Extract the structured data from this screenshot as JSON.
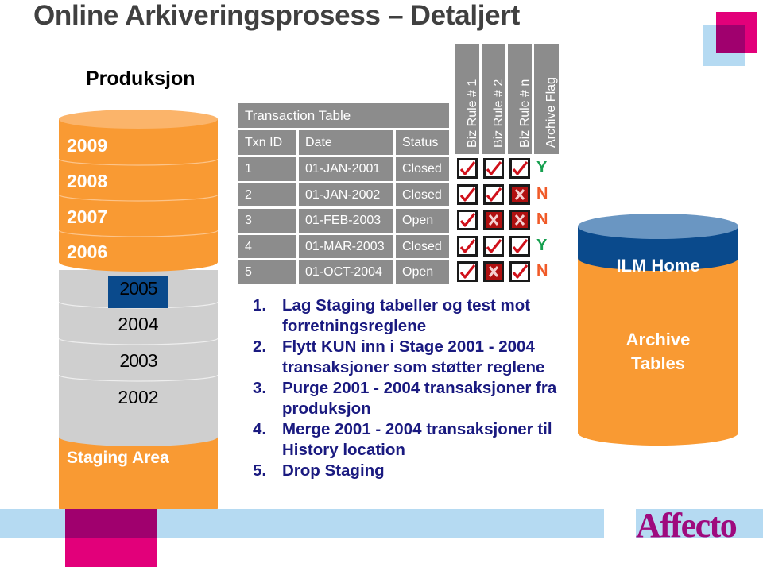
{
  "title": "Online Arkiveringsprosess – Detaljert",
  "production": {
    "label": "Produksjon",
    "years_active": [
      "2009",
      "2008",
      "2007",
      "2006"
    ],
    "year_highlight": "2005",
    "years_staged": [
      "2004",
      "2003",
      "2002"
    ],
    "staging_label": "Staging Area"
  },
  "transaction_table": {
    "title": "Transaction Table",
    "columns": [
      "Txn ID",
      "Date",
      "Status"
    ],
    "rule_columns": [
      "Biz Rule # 1",
      "Biz Rule # 2",
      "Biz Rule # n",
      "Archive Flag"
    ],
    "rows": [
      {
        "id": "1",
        "date": "01-JAN-2001",
        "status": "Closed",
        "rules": [
          true,
          true,
          true
        ],
        "flag": "Y"
      },
      {
        "id": "2",
        "date": "01-JAN-2002",
        "status": "Closed",
        "rules": [
          true,
          true,
          false
        ],
        "flag": "N"
      },
      {
        "id": "3",
        "date": "01-FEB-2003",
        "status": "Open",
        "rules": [
          true,
          false,
          false
        ],
        "flag": "N"
      },
      {
        "id": "4",
        "date": "01-MAR-2003",
        "status": "Closed",
        "rules": [
          true,
          true,
          true
        ],
        "flag": "Y"
      },
      {
        "id": "5",
        "date": "01-OCT-2004",
        "status": "Open",
        "rules": [
          true,
          false,
          true
        ],
        "flag": "N"
      }
    ]
  },
  "steps": [
    {
      "num": "1.",
      "text": "Lag Staging tabeller og test mot forretningsreglene"
    },
    {
      "num": "2.",
      "text": "Flytt KUN inn i Stage 2001 - 2004 transaksjoner som støtter reglene"
    },
    {
      "num": "3.",
      "text": "Purge 2001 - 2004 transaksjoner fra produksjon"
    },
    {
      "num": "4.",
      "text": "Merge 2001 - 2004 transaksjoner til History location"
    },
    {
      "num": "5.",
      "text": "Drop Staging"
    }
  ],
  "ilm": {
    "home_label": "ILM Home",
    "archive_label_line1": "Archive",
    "archive_label_line2": "Tables"
  },
  "brand": {
    "logo_text": "Affecto"
  },
  "colors": {
    "orange": "#f99a33",
    "grey": "#cfcfcf",
    "navy": "#0a4a8c",
    "table_grey": "#8c8c8c",
    "flag_yes": "#17a050",
    "flag_no": "#f05a28",
    "step_text": "#1a1a80",
    "magenta": "#e2007a",
    "light_blue": "#b5daf2"
  }
}
